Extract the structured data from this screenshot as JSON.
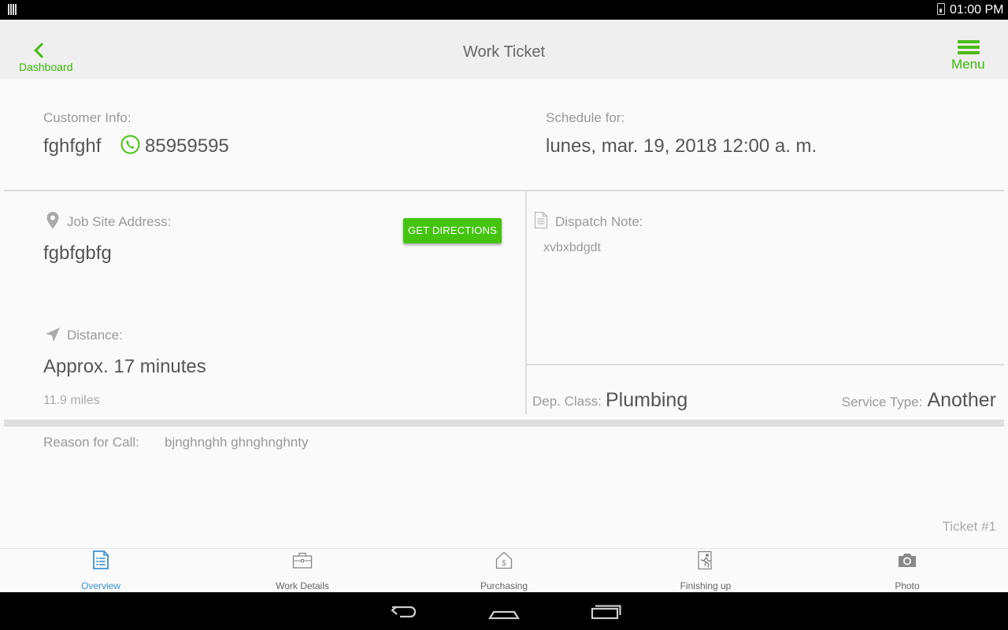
{
  "status_bar": {
    "time": "01:00 PM"
  },
  "header": {
    "back_label": "Dashboard",
    "title": "Work Ticket",
    "menu_label": "Menu"
  },
  "customer": {
    "label": "Customer Info:",
    "name": "fghfghf",
    "phone": "85959595"
  },
  "schedule": {
    "label": "Schedule for:",
    "value": "lunes, mar. 19, 2018 12:00 a. m."
  },
  "job_site": {
    "label": "Job Site Address:",
    "address": "fgbfgbfg",
    "directions_button": "GET DIRECTIONS"
  },
  "distance": {
    "label": "Distance:",
    "value": "Approx. 17 minutes",
    "miles": "11.9 miles"
  },
  "dispatch": {
    "label": "Dispatch Note:",
    "note": "xvbxbdgdt"
  },
  "dep_class": {
    "label": "Dep. Class:",
    "value": "Plumbing"
  },
  "service_type": {
    "label": "Service Type:",
    "value": "Another"
  },
  "reason": {
    "label": "Reason for Call:",
    "value": "bjnghnghh ghnghnghnty"
  },
  "ticket": {
    "label": "Ticket #1"
  },
  "tabs": [
    {
      "label": "Overview",
      "icon": "document-list-icon",
      "active": true
    },
    {
      "label": "Work Details",
      "icon": "briefcase-icon",
      "active": false
    },
    {
      "label": "Purchasing",
      "icon": "house-dollar-icon",
      "active": false
    },
    {
      "label": "Finishing up",
      "icon": "person-exit-icon",
      "active": false
    },
    {
      "label": "Photo",
      "icon": "camera-icon",
      "active": false
    }
  ],
  "colors": {
    "accent_green": "#44c40e",
    "active_tab_blue": "#3b8fd6",
    "text_gray": "#555555",
    "label_gray": "#999999"
  }
}
